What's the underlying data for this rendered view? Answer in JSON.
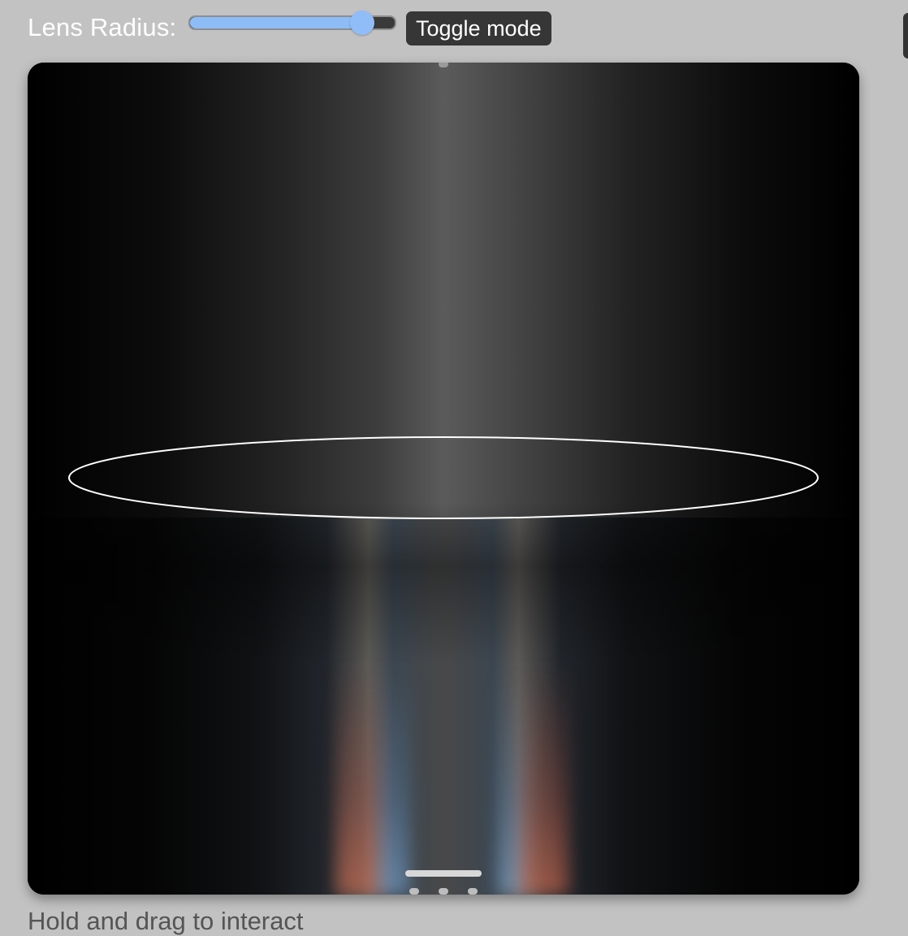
{
  "controls": {
    "lens_radius_label": "Lens Radius:",
    "lens_radius_level": 0.84,
    "toggle_label": "Toggle mode"
  },
  "colors": {
    "page_background": "#c2c2c2",
    "slider_accent": "#8ebcf6",
    "button_background": "#363636",
    "lens_outline": "#ffffff"
  },
  "hint_text": "Hold and drag to interact"
}
